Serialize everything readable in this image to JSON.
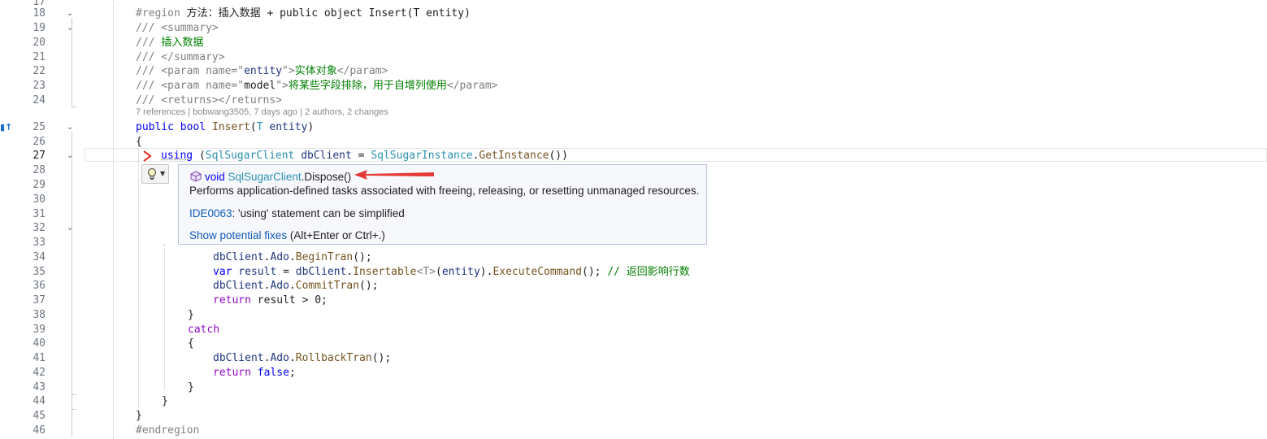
{
  "editor": {
    "line_numbers": [
      "17",
      "18",
      "19",
      "20",
      "21",
      "22",
      "23",
      "24",
      "25",
      "26",
      "27",
      "28",
      "29",
      "30",
      "31",
      "32",
      "33",
      "34",
      "35",
      "36",
      "37",
      "38",
      "39",
      "40",
      "41",
      "42",
      "43",
      "44",
      "45",
      "46"
    ],
    "current_line": "27",
    "codelens": "7 references | bobwang3505, 7 days ago | 2 authors, 2 changes",
    "lines": {
      "l18_region": "#region",
      "l18_title": " 方法：插入数据 + public object Insert(T entity)",
      "l19": "/// <summary>",
      "l20_prefix": "/// ",
      "l20_text": "插入数据",
      "l21": "/// </summary>",
      "l22_prefix": "/// <param name=\"",
      "l22_name": "entity",
      "l22_mid": "\">",
      "l22_text": "实体对象",
      "l22_end": "</param>",
      "l23_prefix": "/// <param name=\"",
      "l23_name": "model",
      "l23_mid": "\">",
      "l23_text": "将某些字段排除，用于自增列使用",
      "l23_end": "</param>",
      "l24": "/// <returns></returns>",
      "l25_public": "public",
      "l25_bool": "bool",
      "l25_method": "Insert",
      "l25_T": "T",
      "l25_param": "entity",
      "l26": "{",
      "l27_using": "using",
      "l27_class": "SqlSugarClient",
      "l27_var": "dbClient",
      "l27_class2": "SqlSugarInstance",
      "l27_method": "GetInstance",
      "l34_obj": "dbClient",
      "l34_ado": "Ado",
      "l34_method": "BeginTran",
      "l35_var": "var",
      "l35_result": "result",
      "l35_obj": "dbClient",
      "l35_method": "Insertable",
      "l35_T": "<T>",
      "l35_entity": "entity",
      "l35_exec": "ExecuteCommand",
      "l35_comment": "// 返回影响行数",
      "l36_obj": "dbClient",
      "l36_ado": "Ado",
      "l36_method": "CommitTran",
      "l37_return": "return",
      "l37_rest": " result > 0;",
      "l38": "}",
      "l39_catch": "catch",
      "l40": "{",
      "l41_obj": "dbClient",
      "l41_ado": "Ado",
      "l41_method": "RollbackTran",
      "l42_return": "return",
      "l42_false": "false",
      "l43": "}",
      "l44": "}",
      "l45": "}",
      "l46": "#endregion"
    }
  },
  "tooltip": {
    "void": "void",
    "class": "SqlSugarClient",
    "method": ".Dispose()",
    "description": "Performs application-defined tasks associated with freeing, releasing, or resetting unmanaged resources.",
    "ide_code": "IDE0063",
    "ide_text": ": 'using' statement can be simplified",
    "fix_link": "Show potential fixes",
    "fix_shortcut": " (Alt+Enter or Ctrl+.)"
  },
  "colors": {
    "keyword": "#0000ff",
    "class": "#2b91af",
    "method": "#74531f",
    "comment": "#008000",
    "link": "#0e5bbc",
    "arrow": "#e53935"
  },
  "icons": {
    "bookmark": "bookmark-arrow-icon",
    "chevron": "chevron-right-icon",
    "bulb": "lightbulb-icon",
    "cube": "method-cube-icon"
  }
}
